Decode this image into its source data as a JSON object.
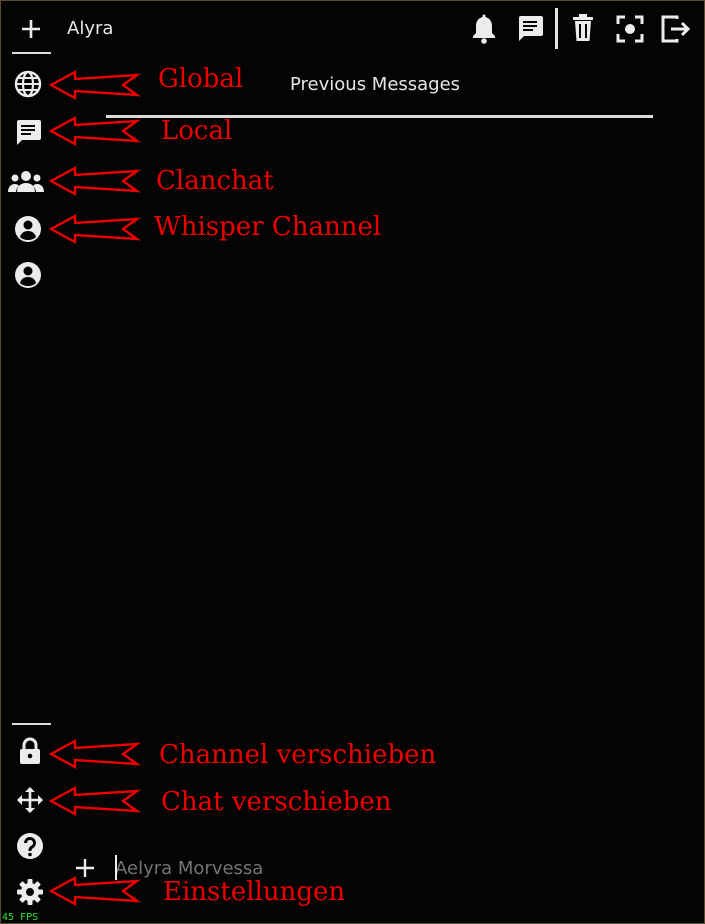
{
  "header": {
    "tab_name": "Alyra",
    "icons": [
      "add-tab-icon",
      "bell-icon",
      "chat-icon",
      "trash-icon",
      "screenshot-icon",
      "logout-icon"
    ]
  },
  "main": {
    "previous_messages": "Previous Messages"
  },
  "sidebar": {
    "channels": [
      {
        "icon": "globe-icon"
      },
      {
        "icon": "chat-bubble-icon"
      },
      {
        "icon": "group-icon"
      },
      {
        "icon": "user-circle-icon"
      },
      {
        "icon": "user-circle-icon"
      }
    ],
    "tools": [
      {
        "icon": "lock-icon"
      },
      {
        "icon": "move-icon"
      },
      {
        "icon": "help-icon"
      },
      {
        "icon": "gear-icon"
      }
    ]
  },
  "annotations": {
    "global": "Global",
    "local": "Local",
    "clanchat": "Clanchat",
    "whisper": "Whisper Channel",
    "channel_move": "Channel verschieben",
    "chat_move": "Chat verschieben",
    "settings": "Einstellungen"
  },
  "input": {
    "placeholder": "Aelyra Morvessa"
  },
  "fps": "45 FPS",
  "colors": {
    "background": "#040404",
    "icon": "#ececec",
    "annotation": "#ee0000",
    "fps": "#2ee62e"
  }
}
